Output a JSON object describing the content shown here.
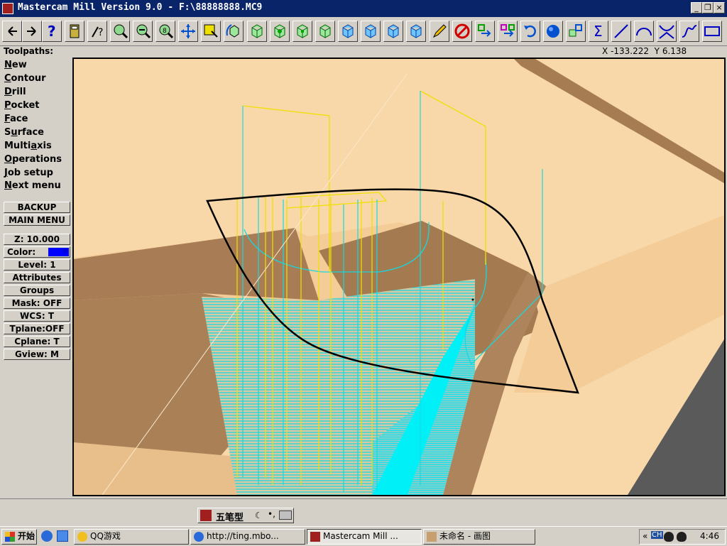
{
  "window": {
    "title": "Mastercam Mill Version 9.0 - F:\\88888888.MC9",
    "minimize_glyph": "_",
    "restore_glyph": "❐",
    "close_glyph": "×"
  },
  "toolbar": {
    "icons": [
      "back-arrow",
      "forward-arrow",
      "help",
      "calculator",
      "analyze",
      "zoom",
      "unzoom",
      "zoom-target",
      "pan",
      "select-box",
      "rotate-cube",
      "view-top",
      "view-front",
      "view-side",
      "view-iso",
      "view-solid-1",
      "view-solid-2",
      "view-solid-3",
      "view-solid-4",
      "pencil",
      "delete",
      "translate",
      "mirror",
      "undo",
      "shade-sphere",
      "transform",
      "sum",
      "line",
      "arc",
      "fillet",
      "spline",
      "rectangle"
    ]
  },
  "status": {
    "toolpaths_label": "Toolpaths:",
    "x_label": "X",
    "x_value": "-133.222",
    "y_label": "Y",
    "y_value": "6.138"
  },
  "menu": {
    "items": [
      {
        "hot": "N",
        "rest": "ew"
      },
      {
        "hot": "C",
        "rest": "ontour"
      },
      {
        "hot": "D",
        "rest": "rill"
      },
      {
        "hot": "P",
        "rest": "ocket"
      },
      {
        "hot": "F",
        "rest": "ace"
      },
      {
        "pre": "S",
        "hot": "u",
        "rest": "rface"
      },
      {
        "pre": "Multi",
        "hot": "a",
        "rest": "xis"
      },
      {
        "hot": "O",
        "rest": "perations"
      },
      {
        "hot": "J",
        "rest": "ob setup"
      },
      {
        "hot": "N",
        "rest": "ext menu"
      }
    ],
    "backup": "BACKUP",
    "main_menu": "MAIN MENU"
  },
  "settings": {
    "z": "Z:  10.000",
    "color_label": "Color:",
    "color_value": "9",
    "color_swatch": "#0000ff",
    "level": "Level:  1",
    "attributes": "Attributes",
    "groups": "Groups",
    "mask": "Mask:  OFF",
    "wcs": "WCS:   T",
    "tplane": "Tplane:OFF",
    "cplane": "Cplane:  T",
    "gview": "Gview:   M"
  },
  "viewport_colors": {
    "background": "#f8d7a8",
    "wall": "#a67c52",
    "toolpath_cyan": "#00e5ee",
    "toolpath_yellow": "#f0e000",
    "boundary": "#000000"
  },
  "ime": {
    "label": "五笔型"
  },
  "taskbar": {
    "start": "开始",
    "buttons": [
      {
        "label": "QQ游戏"
      },
      {
        "label": "http://ting.mbo..."
      },
      {
        "label": "Mastercam Mill ..."
      },
      {
        "label": "未命名 - 画图"
      }
    ],
    "tray_expand": "«",
    "tray_ch": "CH",
    "time": "4:46"
  }
}
